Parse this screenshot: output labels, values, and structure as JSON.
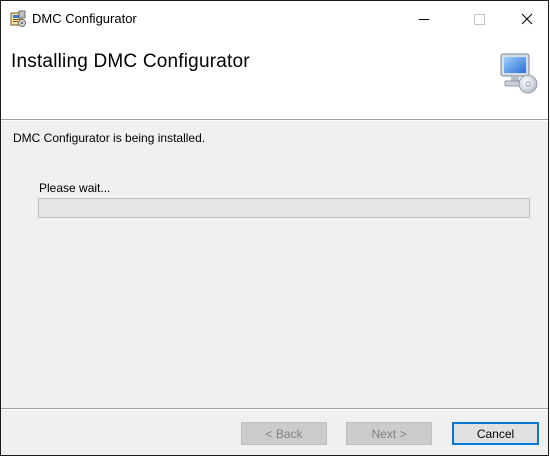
{
  "window": {
    "title": "DMC Configurator",
    "controls": {
      "minimize": "—",
      "maximize": "☐",
      "close": "✕"
    }
  },
  "banner": {
    "title": "Installing DMC Configurator",
    "icon": "computer-cd-icon"
  },
  "body": {
    "status": "DMC Configurator is being installed.",
    "wait": "Please wait...",
    "progress": 0
  },
  "footer": {
    "back_label": "< Back",
    "next_label": "Next >",
    "cancel_label": "Cancel"
  },
  "colors": {
    "accent": "#0078d7",
    "progress_fill": "#06b025"
  }
}
